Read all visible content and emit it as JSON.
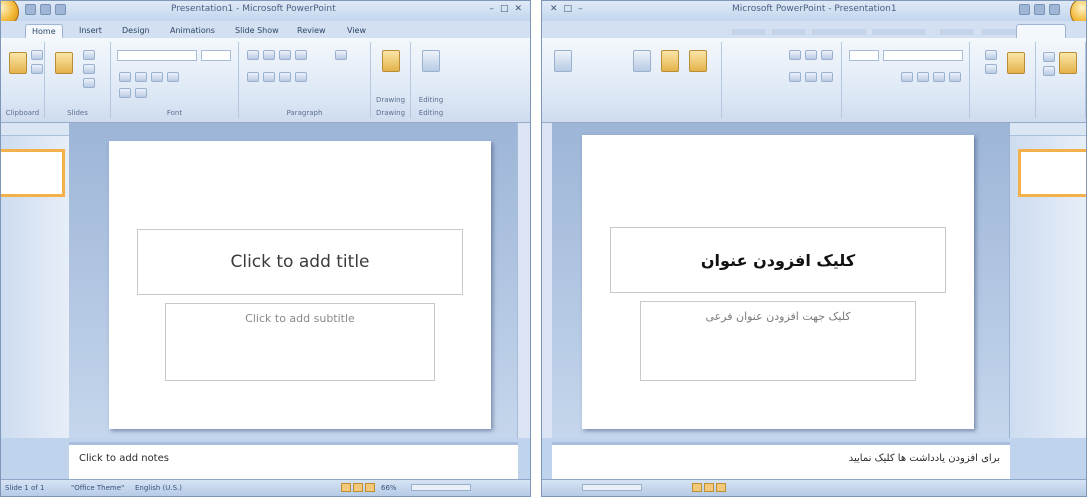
{
  "left_window": {
    "title": "Presentation1 - Microsoft PowerPoint",
    "tabs": [
      "Home",
      "Insert",
      "Design",
      "Animations",
      "Slide Show",
      "Review",
      "View"
    ],
    "ribbon_groups": [
      "Clipboard",
      "Slides",
      "Font",
      "Paragraph",
      "Drawing",
      "Editing"
    ],
    "ribbon_buttons": {
      "paste": "Paste",
      "new_slide": "New Slide",
      "drawing": "Drawing",
      "editing": "Editing"
    },
    "slide_title_placeholder": "Click to add title",
    "slide_subtitle_placeholder": "Click to add subtitle",
    "notes_placeholder": "Click to add notes",
    "status": {
      "slide": "Slide 1 of 1",
      "theme": "\"Office Theme\"",
      "language": "English (U.S.)",
      "zoom": "66%"
    }
  },
  "right_window": {
    "title": "Microsoft PowerPoint - Presentation1",
    "slide_title_placeholder": "کلیک افزودن عنوان",
    "slide_subtitle_placeholder": "کلیک جهت افزودن عنوان فرعی",
    "notes_placeholder": "برای افزودن یادداشت ها کلیک نمایید"
  },
  "colors": {
    "ribbon": "#dce7f5",
    "frame": "#bfd3ec",
    "accent": "#f2b14a"
  }
}
